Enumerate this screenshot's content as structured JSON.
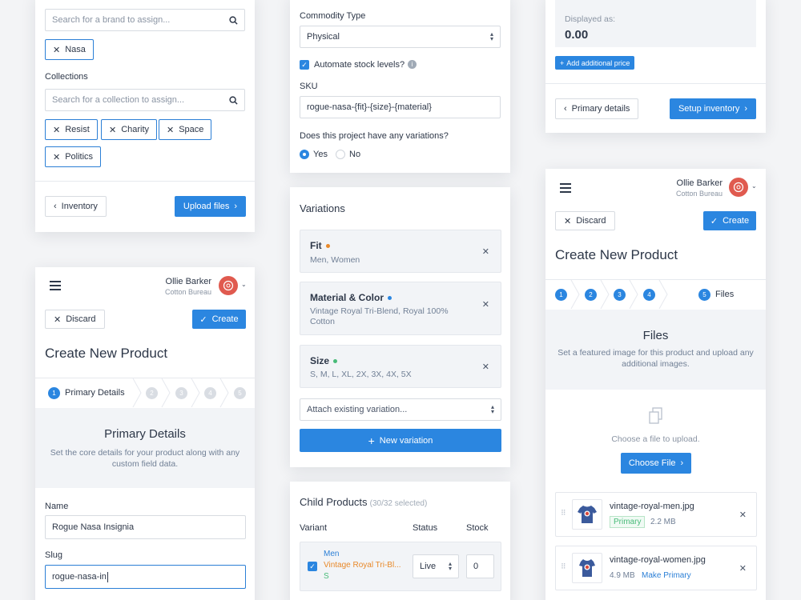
{
  "card1": {
    "brand_search_placeholder": "Search for a brand to assign...",
    "brand_tags": [
      "Nasa"
    ],
    "collections_label": "Collections",
    "collection_search_placeholder": "Search for a collection to assign...",
    "collection_tags": [
      "Resist",
      "Charity",
      "Space",
      "Politics"
    ],
    "back_button": "Inventory",
    "next_button": "Upload files"
  },
  "card2": {
    "user_name": "Ollie Barker",
    "user_org": "Cotton Bureau",
    "discard": "Discard",
    "create": "Create",
    "title": "Create New Product",
    "steps": [
      "1",
      "2",
      "3",
      "4",
      "5"
    ],
    "active_step_label": "Primary Details",
    "section_title": "Primary Details",
    "section_desc": "Set the core details for your product along with any custom field data.",
    "name_label": "Name",
    "name_value": "Rogue Nasa Insignia",
    "slug_label": "Slug",
    "slug_value": "rogue-nasa-in"
  },
  "card3": {
    "commodity_label": "Commodity Type",
    "commodity_value": "Physical",
    "automate_label": "Automate stock levels?",
    "sku_label": "SKU",
    "sku_value": "rogue-nasa-{fit}-{size}-{material}",
    "variations_question": "Does this project have any variations?",
    "yes": "Yes",
    "no": "No"
  },
  "card4": {
    "title": "Variations",
    "variations": [
      {
        "name": "Fit",
        "values": "Men, Women",
        "dot_color": "#e8892a"
      },
      {
        "name": "Material & Color",
        "values": "Vintage Royal Tri-Blend, Royal 100% Cotton",
        "dot_color": "#2b86e0"
      },
      {
        "name": "Size",
        "values": "S, M, L, XL, 2X, 3X, 4X, 5X",
        "dot_color": "#48bb78"
      }
    ],
    "attach_placeholder": "Attach existing variation...",
    "new_variation": "New variation"
  },
  "card5": {
    "title": "Child Products",
    "count": "(30/32 selected)",
    "col_variant": "Variant",
    "col_status": "Status",
    "col_stock": "Stock",
    "row": {
      "fit": "Men",
      "material": "Vintage Royal Tri-Bl...",
      "size": "S",
      "status": "Live",
      "stock": "0"
    }
  },
  "card6": {
    "displayed_as_label": "Displayed as:",
    "displayed_value": "0.00",
    "add_price": "Add additional price",
    "back_button": "Primary details",
    "next_button": "Setup inventory"
  },
  "card7": {
    "user_name": "Ollie Barker",
    "user_org": "Cotton Bureau",
    "discard": "Discard",
    "create": "Create",
    "title": "Create New Product",
    "steps": [
      "1",
      "2",
      "3",
      "4",
      "5"
    ],
    "active_step_label": "Files",
    "section_title": "Files",
    "section_desc": "Set a featured image for this product and upload any additional images.",
    "upload_hint": "Choose a file to upload.",
    "choose_file": "Choose File",
    "files": [
      {
        "name": "vintage-royal-men.jpg",
        "badge": "Primary",
        "size": "2.2 MB"
      },
      {
        "name": "vintage-royal-women.jpg",
        "size": "4.9 MB",
        "action": "Make Primary"
      }
    ]
  },
  "colors": {
    "accent": "#2b86e0",
    "primary_badge": "#48bb78",
    "orange": "#e8892a",
    "avatar": "#e05a4f"
  }
}
